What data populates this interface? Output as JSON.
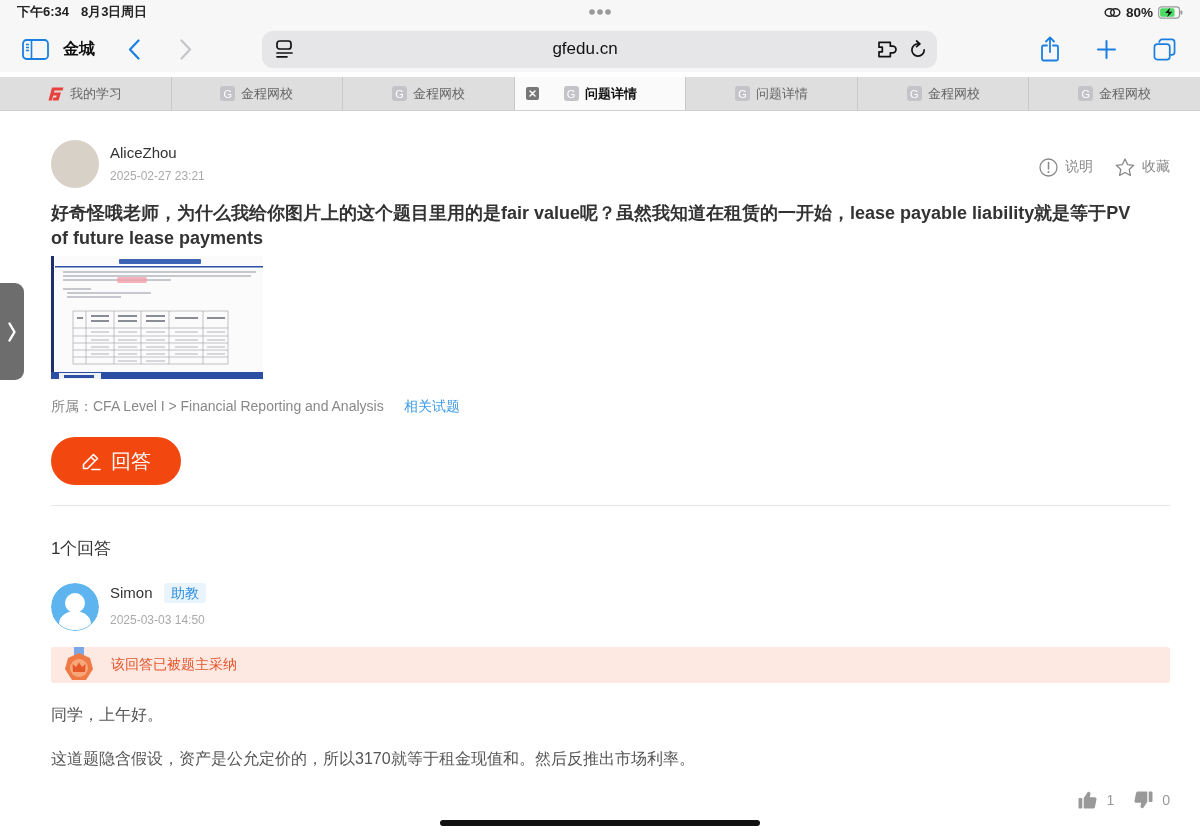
{
  "status_bar": {
    "time": "下午6:34",
    "date": "8月3日周日",
    "battery": "80%"
  },
  "toolbar": {
    "profile": "金城",
    "nav": [
      {
        "kind": "back",
        "disabled": false
      },
      {
        "kind": "forward",
        "disabled": true
      }
    ],
    "url": "gfedu.cn"
  },
  "tabs": [
    {
      "label": "我的学习",
      "kind": "logo",
      "selected": false
    },
    {
      "label": "金程网校",
      "kind": "letter",
      "letter": "G",
      "selected": false
    },
    {
      "label": "金程网校",
      "kind": "letter",
      "letter": "G",
      "selected": false
    },
    {
      "label": "问题详情",
      "kind": "letter",
      "letter": "G",
      "selected": true
    },
    {
      "label": "问题详情",
      "kind": "letter",
      "letter": "G",
      "selected": false
    },
    {
      "label": "金程网校",
      "kind": "letter",
      "letter": "G",
      "selected": false
    },
    {
      "label": "金程网校",
      "kind": "letter",
      "letter": "G",
      "selected": false
    }
  ],
  "question": {
    "author": "AliceZhou",
    "time": "2025-02-27 23:21",
    "actions": [
      {
        "kind": "info",
        "label": "说明"
      },
      {
        "kind": "star",
        "label": "收藏",
        "starred": false
      }
    ],
    "text": "好奇怪哦老师，为什么我给你图片上的这个题目里用的是fair value呢？虽然我知道在租赁的一开始，lease payable liability就是等于PV of future lease payments",
    "category": "所属：CFA Level I > Financial Reporting and Analysis",
    "related_link": "相关试题",
    "answer_button": "回答"
  },
  "answer_count": "1个回答",
  "answers": [
    {
      "author": "Simon",
      "role": "助教",
      "time": "2025-03-03 14:50",
      "accepted": true,
      "accepted_text": "该回答已被题主采纳",
      "paragraphs": [
        "同学，上午好。",
        "这道题隐含假设，资产是公允定价的，所以3170就等于租金现值和。然后反推出市场利率。"
      ],
      "likes": "1",
      "dislikes": "0"
    }
  ]
}
